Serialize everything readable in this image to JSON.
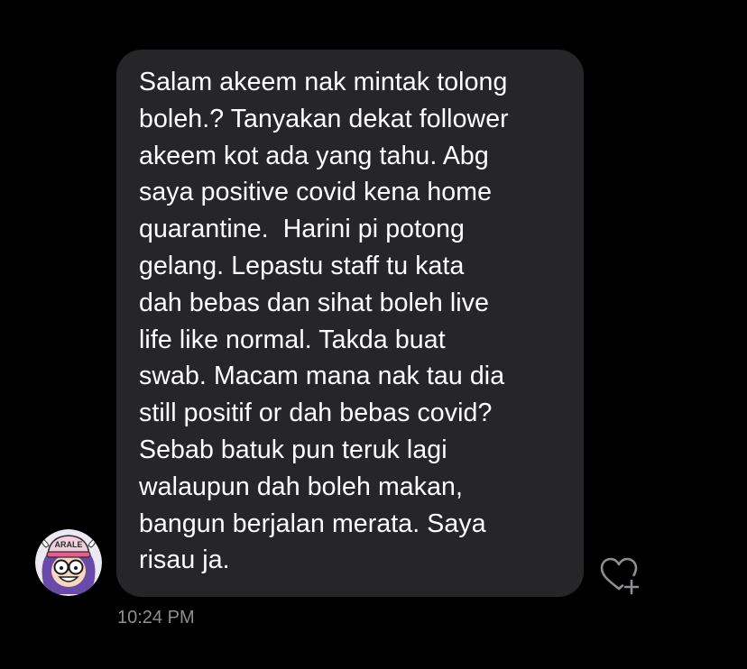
{
  "message": {
    "lines": [
      "Salam akeem nak mintak tolong",
      "boleh.? Tanyakan dekat follower",
      "akeem kot ada yang tahu. Abg",
      "saya positive covid kena home",
      "quarantine.  Harini pi potong",
      "gelang. Lepastu staff tu kata",
      "dah bebas dan sihat boleh live",
      "life like normal. Takda buat",
      "swab. Macam mana nak tau dia",
      "still positif or dah bebas covid?",
      "Sebab batuk pun teruk lagi",
      "walaupun dah boleh makan,",
      "bangun berjalan merata. Saya",
      "risau ja."
    ],
    "timestamp": "10:24 PM"
  },
  "avatar": {
    "cap_text": "ARALE",
    "icon": "avatar-cartoon-girl"
  },
  "react_button": {
    "icon": "heart-add-icon"
  },
  "colors": {
    "background": "#000000",
    "bubble": "#262629",
    "text": "#ffffff",
    "timestamp": "#8e8e93"
  }
}
